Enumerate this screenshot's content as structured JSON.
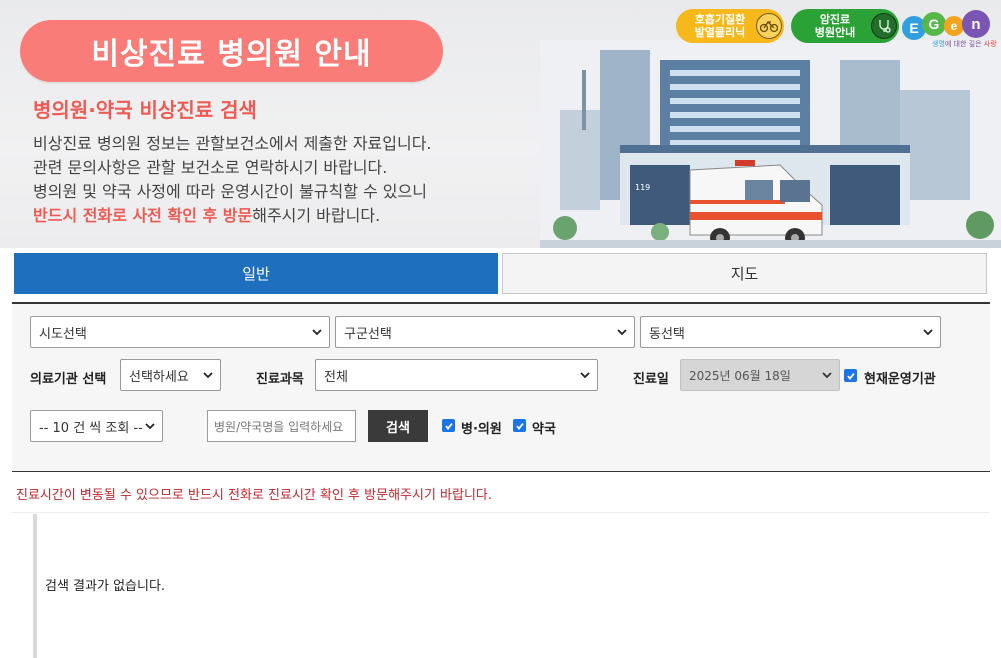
{
  "banner": {
    "title": "비상진료 병의원 안내",
    "subtitle": "병의원·약국 비상진료 검색",
    "desc_line1": "비상진료 병의원 정보는 관할보건소에서 제출한 자료입니다.",
    "desc_line2": "관련 문의사항은 관할 보건소로 연락하시기 바랍니다.",
    "desc_line3": "병의원 및 약국 사정에 따라 운영시간이 불규칙할 수 있으니",
    "desc_line4_highlight": "반드시 전화로 사전 확인 후 방문",
    "desc_line4_rest": "해주시기 바랍니다.",
    "pill_respiratory_line1": "호흡기질환",
    "pill_respiratory_line2": "발열클리닉",
    "pill_respiratory_icon": "bicycle-icon",
    "pill_cancer_line1": "암진료",
    "pill_cancer_line2": "병원안내",
    "pill_cancer_icon": "stethoscope-icon",
    "logo_letters": [
      "E",
      "G",
      "e",
      "n"
    ],
    "logo_tagline_a": "생명",
    "logo_tagline_b": "에 대한 깊은 ",
    "logo_tagline_c": "사랑",
    "ambulance_sign": "119"
  },
  "tabs": {
    "general": "일반",
    "map": "지도"
  },
  "filters": {
    "sido": "시도선택",
    "gugun": "구군선택",
    "dong": "동선택",
    "institution_label": "의료기관 선택",
    "institution_value": "선택하세요",
    "department_label": "진료과목",
    "department_value": "전체",
    "date_label": "진료일",
    "date_value": "2025년 06월 18일",
    "currently_open_label": "현재운영기관",
    "page_size": "-- 10 건 씩 조회 --",
    "name_placeholder": "병원/약국명을 입력하세요",
    "search_button": "검색",
    "hospital_check_label": "병·의원",
    "pharmacy_check_label": "약국"
  },
  "notice": "진료시간이 변동될 수 있으므로 반드시 전화로 진료시간 확인 후 방문해주시기 바랍니다.",
  "result": {
    "empty_message": "검색 결과가 없습니다."
  },
  "colors": {
    "accent_coral": "#fa7c78",
    "tab_active_blue": "#1f6fbf",
    "notice_red": "#c0272d",
    "pill_yellow": "#f6b81a",
    "pill_green": "#2aa236"
  }
}
